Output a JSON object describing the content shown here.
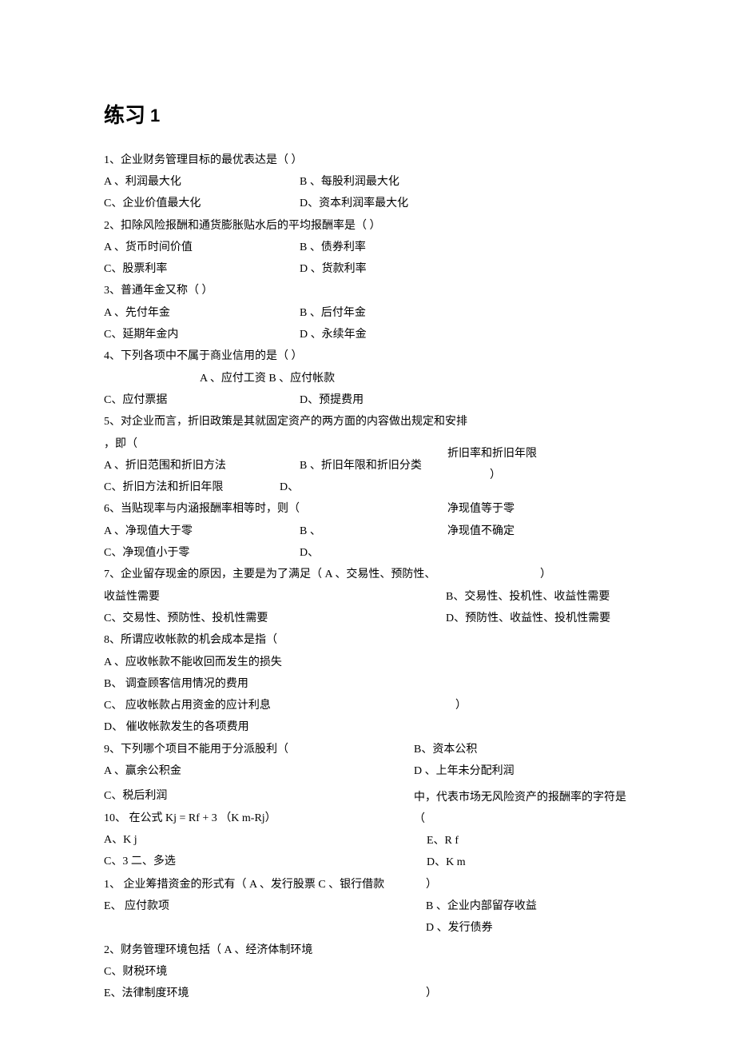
{
  "title_main": "练习",
  "title_num": "1",
  "q1_stem": "1、企业财务管理目标的最优表达是（            ）",
  "q1_a": "A 、利润最大化",
  "q1_b": "B 、每股利润最大化",
  "q1_c": "C、企业价值最大化",
  "q1_d": "D、资本利润率最大化",
  "q2_stem": "2、扣除风险报酬和通货膨胀贴水后的平均报酬率是（               ）",
  "q2_a": "A 、货币时间价值",
  "q2_b": "B 、债券利率",
  "q2_c": "C、股票利率",
  "q2_d": "D 、货款利率",
  "q3_stem": "3、普通年金又称（            ）",
  "q3_a": "A 、先付年金",
  "q3_b": "B 、后付年金",
  "q3_c": "C、延期年金内",
  "q3_d": "D 、永续年金",
  "q4_stem": "4、下列各项中不属于商业信用的是（                ）",
  "q4_ab": "A 、应付工资  B 、应付帐款",
  "q4_c": "C、应付票据",
  "q4_d": "D、预提费用",
  "q5_stem1": "5、对企业而言，折旧政策是其就固定资产的两方面的内容做出规定和安排",
  "q5_stem2": "，即（",
  "q5_a": "A 、折旧范围和折旧方法",
  "q5_b": "B 、折旧年限和折旧分类",
  "q5_c": "C、折旧方法和折旧年限",
  "q5_d": "D、",
  "q5_right1": "折旧率和折旧年限",
  "q5_right2": "）",
  "q6_stem": "6、当贴现率与内涵报酬率相等时，则（",
  "q6_a": "A 、净现值大于零",
  "q6_bmark": "B 、",
  "q6_c": "C、净现值小于零",
  "q6_dmark": "D、",
  "q6_right1": "净现值等于零",
  "q6_right2": "净现值不确定",
  "q7_stem": "7、企业留存现金的原因，主要是为了满足（ A 、交易性、预防性、收益性需要",
  "q7_c": "C、交易性、预防性、投机性需要",
  "q7_rparen": "）",
  "q7_b": "B、交易性、投机性、收益性需要",
  "q7_d": "D、预防性、收益性、投机性需要",
  "q8_stem": "8、所谓应收帐款的机会成本是指（",
  "q8_a": "A 、应收帐款不能收回而发生的损失",
  "q8_b": "B、   调查顾客信用情况的费用",
  "q8_c": "C、   应收帐款占用资金的应计利息",
  "q8_d": "D、   催收帐款发生的各项费用",
  "q8_rparen": "）",
  "q9_stem": "9、下列哪个项目不能用于分派股利（",
  "q9_a": "A 、赢余公积金",
  "q9_b": "B、资本公积",
  "q9_c": "C、税后利润",
  "q9_d": "D 、上年未分配利润",
  "q10_stem": "10、 在公式 Kj = Rf + 3 （K m-Rj）",
  "q10_a": "A、K j",
  "q10_c": "C、3 二、多选",
  "q10_right1": "中，代表市场无风险资产的报酬率的字符是（",
  "q10_e": "E、R f",
  "q10_d": "D、K m",
  "m1_stem": "1、 企业筹措资金的形式有（ A 、发行股票 C 、银行借款",
  "m1_e": "E、 应付款项",
  "m1_rparen": "）",
  "m1_b": "B 、企业内部留存收益",
  "m1_d": "D 、发行债券",
  "m2_stem": "2、财务管理环境包括（ A 、经济体制环境",
  "m2_c": "C、财税环境",
  "m2_e": "E、法律制度环境",
  "m2_rparen": "）"
}
